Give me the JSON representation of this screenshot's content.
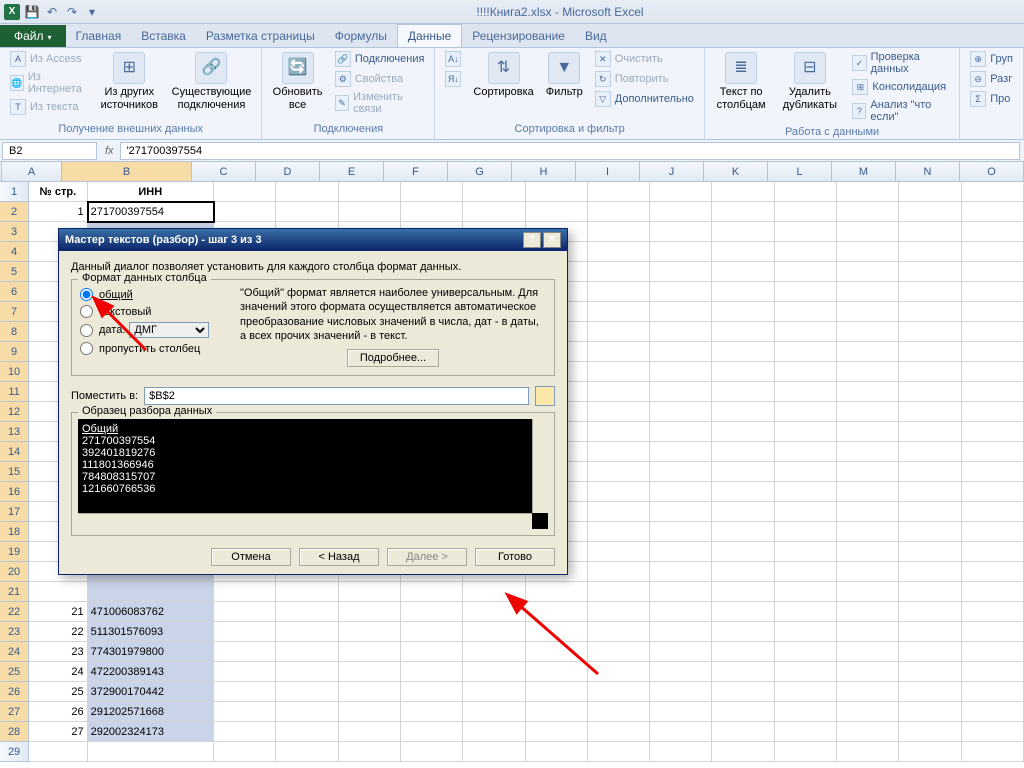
{
  "title": "!!!!Книга2.xlsx - Microsoft Excel",
  "tabs": {
    "file": "Файл",
    "home": "Главная",
    "insert": "Вставка",
    "page_layout": "Разметка страницы",
    "formulas": "Формулы",
    "data": "Данные",
    "review": "Рецензирование",
    "view": "Вид"
  },
  "ribbon": {
    "group1": {
      "access": "Из Access",
      "web": "Из Интернета",
      "text": "Из текста",
      "other": "Из других источников",
      "existing": "Существующие подключения",
      "label": "Получение внешних данных"
    },
    "group2": {
      "refresh": "Обновить все",
      "connections": "Подключения",
      "properties": "Свойства",
      "edit_links": "Изменить связи",
      "label": "Подключения"
    },
    "group3": {
      "sort_az": "А↓Я",
      "sort_za": "Я↓А",
      "sort": "Сортировка",
      "filter": "Фильтр",
      "clear": "Очистить",
      "reapply": "Повторить",
      "advanced": "Дополнительно",
      "label": "Сортировка и фильтр"
    },
    "group4": {
      "text_to_cols": "Текст по столбцам",
      "remove_dup": "Удалить дубликаты",
      "validation": "Проверка данных",
      "consolidate": "Консолидация",
      "whatif": "Анализ \"что если\"",
      "label": "Работа с данными"
    },
    "group5": {
      "group": "Груп",
      "ungroup": "Разг",
      "subtotal": "Про"
    }
  },
  "name_box": "B2",
  "formula": "'271700397554",
  "columns": [
    "A",
    "B",
    "C",
    "D",
    "E",
    "F",
    "G",
    "H",
    "I",
    "J",
    "K",
    "L",
    "M",
    "N",
    "O"
  ],
  "col_widths": {
    "A": 60,
    "B": 130
  },
  "headers": {
    "A": "№ стр.",
    "B": "ИНН"
  },
  "row2": {
    "A": "1",
    "B": "271700397554"
  },
  "visible_rows_after": [
    {
      "n": 21,
      "a": "21",
      "b": "471006083762"
    },
    {
      "n": 22,
      "a": "22",
      "b": "511301576093"
    },
    {
      "n": 23,
      "a": "23",
      "b": "774301979800"
    },
    {
      "n": 24,
      "a": "24",
      "b": "472200389143"
    },
    {
      "n": 25,
      "a": "25",
      "b": "372900170442"
    },
    {
      "n": 26,
      "a": "26",
      "b": "291202571668"
    },
    {
      "n": 27,
      "a": "27",
      "b": "292002324173"
    }
  ],
  "dialog": {
    "title": "Мастер текстов (разбор) - шаг 3 из 3",
    "intro": "Данный диалог позволяет установить для каждого столбца формат данных.",
    "fieldset": "Формат данных столбца",
    "radio_general": "общий",
    "radio_text": "текстовый",
    "radio_date": "дата:",
    "date_format": "ДМГ",
    "radio_skip": "пропустить столбец",
    "desc": "\"Общий\" формат является наиболее универсальным. Для значений этого формата осуществляется автоматическое преобразование числовых значений в числа, дат - в даты, а всех прочих значений - в текст.",
    "details_btn": "Подробнее...",
    "dest_label": "Поместить в:",
    "dest_value": "$B$2",
    "sample_label": "Образец разбора данных",
    "sample_header": "Общий",
    "sample_rows": [
      "271700397554",
      "392401819276",
      "111801366946",
      "784808315707",
      "121660766536"
    ],
    "btn_cancel": "Отмена",
    "btn_back": "< Назад",
    "btn_next": "Далее >",
    "btn_finish": "Готово"
  }
}
